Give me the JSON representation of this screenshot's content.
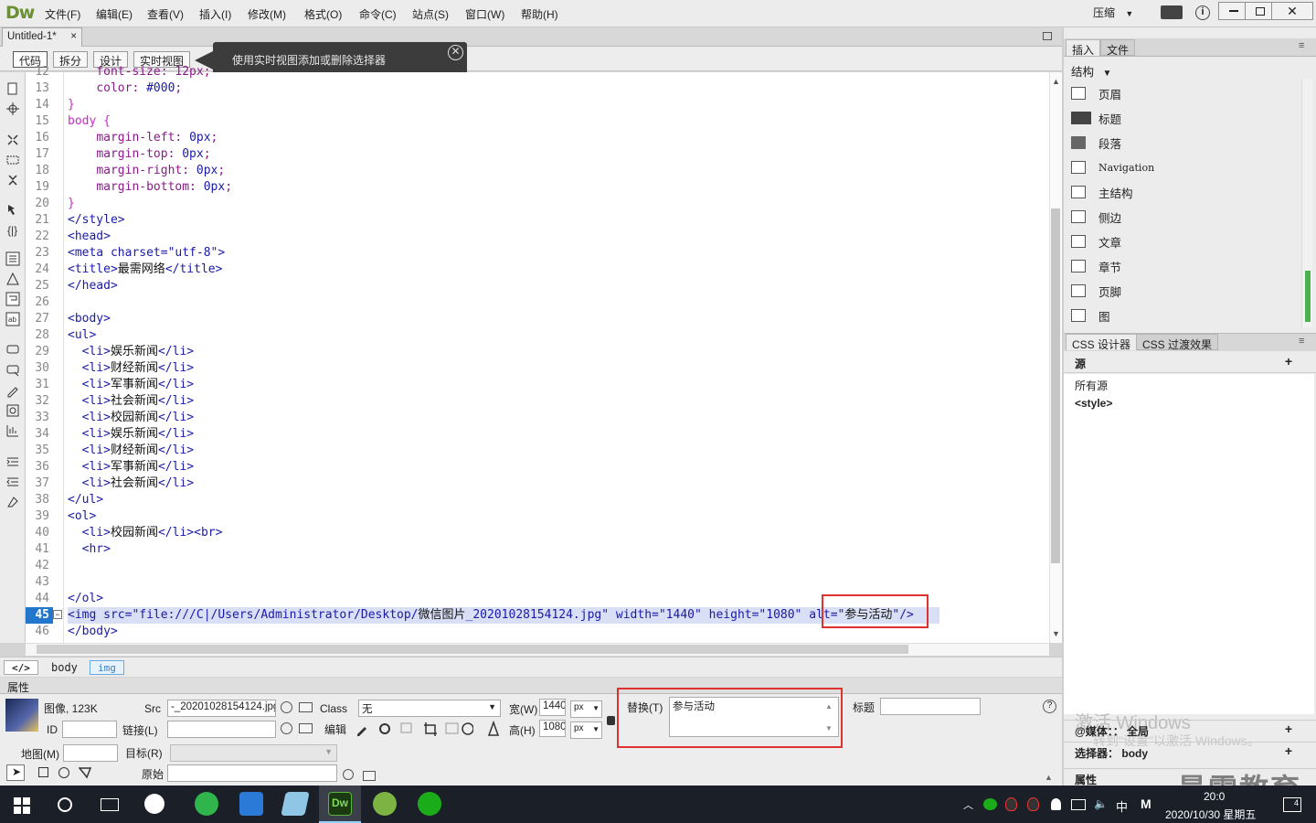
{
  "app": {
    "logo": "Dw",
    "layout_mode": "压缩"
  },
  "menu": [
    "文件(F)",
    "编辑(E)",
    "查看(V)",
    "插入(I)",
    "修改(M)",
    "格式(O)",
    "命令(C)",
    "站点(S)",
    "窗口(W)",
    "帮助(H)"
  ],
  "document": {
    "tab_title": "Untitled-1*",
    "close": "×"
  },
  "views": [
    "代码",
    "拆分",
    "设计",
    "实时视图"
  ],
  "tooltip": {
    "text": "使用实时视图添加或删除选择器",
    "close": "✕"
  },
  "code_lines": [
    {
      "n": "12",
      "indent": "    ",
      "parts": [
        [
          "prop",
          "font-size: 12px;"
        ]
      ]
    },
    {
      "n": "13",
      "indent": "    ",
      "parts": [
        [
          "prop",
          "color: "
        ],
        [
          "val",
          "#000"
        ],
        [
          "prop",
          ";"
        ]
      ]
    },
    {
      "n": "14",
      "indent": "",
      "parts": [
        [
          "sel",
          "}"
        ]
      ]
    },
    {
      "n": "15",
      "indent": "",
      "parts": [
        [
          "sel",
          "body {"
        ]
      ]
    },
    {
      "n": "16",
      "indent": "    ",
      "parts": [
        [
          "prop",
          "margin-left: "
        ],
        [
          "val",
          "0px"
        ],
        [
          "prop",
          ";"
        ]
      ]
    },
    {
      "n": "17",
      "indent": "    ",
      "parts": [
        [
          "prop",
          "margin-top: "
        ],
        [
          "val",
          "0px"
        ],
        [
          "prop",
          ";"
        ]
      ]
    },
    {
      "n": "18",
      "indent": "    ",
      "parts": [
        [
          "prop",
          "margin-right: "
        ],
        [
          "val",
          "0px"
        ],
        [
          "prop",
          ";"
        ]
      ]
    },
    {
      "n": "19",
      "indent": "    ",
      "parts": [
        [
          "prop",
          "margin-bottom: "
        ],
        [
          "val",
          "0px"
        ],
        [
          "prop",
          ";"
        ]
      ]
    },
    {
      "n": "20",
      "indent": "",
      "parts": [
        [
          "sel",
          "}"
        ]
      ]
    },
    {
      "n": "21",
      "indent": "",
      "parts": [
        [
          "tag",
          "</style>"
        ]
      ]
    },
    {
      "n": "22",
      "indent": "",
      "parts": [
        [
          "tag",
          "<head>"
        ]
      ]
    },
    {
      "n": "23",
      "indent": "",
      "parts": [
        [
          "tag",
          "<meta charset=\"utf-8\">"
        ]
      ]
    },
    {
      "n": "24",
      "indent": "",
      "parts": [
        [
          "tag",
          "<title>"
        ],
        [
          "txt",
          "最需网络"
        ],
        [
          "tag",
          "</title>"
        ]
      ]
    },
    {
      "n": "25",
      "indent": "",
      "parts": [
        [
          "tag",
          "</head>"
        ]
      ]
    },
    {
      "n": "26",
      "indent": "",
      "parts": []
    },
    {
      "n": "27",
      "indent": "",
      "parts": [
        [
          "tag",
          "<body>"
        ]
      ]
    },
    {
      "n": "28",
      "indent": "",
      "parts": [
        [
          "tag",
          "<ul>"
        ]
      ]
    },
    {
      "n": "29",
      "indent": "  ",
      "parts": [
        [
          "tag",
          "<li>"
        ],
        [
          "txt",
          "娱乐新闻"
        ],
        [
          "tag",
          "</li>"
        ]
      ]
    },
    {
      "n": "30",
      "indent": "  ",
      "parts": [
        [
          "tag",
          "<li>"
        ],
        [
          "txt",
          "财经新闻"
        ],
        [
          "tag",
          "</li>"
        ]
      ]
    },
    {
      "n": "31",
      "indent": "  ",
      "parts": [
        [
          "tag",
          "<li>"
        ],
        [
          "txt",
          "军事新闻"
        ],
        [
          "tag",
          "</li>"
        ]
      ]
    },
    {
      "n": "32",
      "indent": "  ",
      "parts": [
        [
          "tag",
          "<li>"
        ],
        [
          "txt",
          "社会新闻"
        ],
        [
          "tag",
          "</li>"
        ]
      ]
    },
    {
      "n": "33",
      "indent": "  ",
      "parts": [
        [
          "tag",
          "<li>"
        ],
        [
          "txt",
          "校园新闻"
        ],
        [
          "tag",
          "</li>"
        ]
      ]
    },
    {
      "n": "34",
      "indent": "  ",
      "parts": [
        [
          "tag",
          "<li>"
        ],
        [
          "txt",
          "娱乐新闻"
        ],
        [
          "tag",
          "</li>"
        ]
      ]
    },
    {
      "n": "35",
      "indent": "  ",
      "parts": [
        [
          "tag",
          "<li>"
        ],
        [
          "txt",
          "财经新闻"
        ],
        [
          "tag",
          "</li>"
        ]
      ]
    },
    {
      "n": "36",
      "indent": "  ",
      "parts": [
        [
          "tag",
          "<li>"
        ],
        [
          "txt",
          "军事新闻"
        ],
        [
          "tag",
          "</li>"
        ]
      ]
    },
    {
      "n": "37",
      "indent": "  ",
      "parts": [
        [
          "tag",
          "<li>"
        ],
        [
          "txt",
          "社会新闻"
        ],
        [
          "tag",
          "</li>"
        ]
      ]
    },
    {
      "n": "38",
      "indent": "",
      "parts": [
        [
          "tag",
          "</ul>"
        ]
      ]
    },
    {
      "n": "39",
      "indent": "",
      "parts": [
        [
          "tag",
          "<ol>"
        ]
      ]
    },
    {
      "n": "40",
      "indent": "  ",
      "parts": [
        [
          "tag",
          "<li>"
        ],
        [
          "txt",
          "校园新闻"
        ],
        [
          "tag",
          "</li><br>"
        ]
      ]
    },
    {
      "n": "41",
      "indent": "  ",
      "parts": [
        [
          "tag",
          "<hr>"
        ]
      ]
    },
    {
      "n": "42",
      "indent": "",
      "parts": []
    },
    {
      "n": "43",
      "indent": "",
      "parts": []
    },
    {
      "n": "44",
      "indent": "",
      "parts": [
        [
          "tag",
          "</ol>"
        ]
      ]
    },
    {
      "n": "45",
      "indent": "",
      "active": true,
      "parts": [
        [
          "tag",
          "<img src=\"file:///C|/Users/Administrator/Desktop/"
        ],
        [
          "txt",
          "微信图片"
        ],
        [
          "tag",
          "_20201028154124.jpg\" width=\"1440\" height=\"1080\" alt=\""
        ],
        [
          "txt",
          "参与活动"
        ],
        [
          "tag",
          "\"/>"
        ]
      ]
    },
    {
      "n": "46",
      "indent": "",
      "parts": [
        [
          "tag",
          "</body>"
        ]
      ]
    }
  ],
  "tag_selector": {
    "code_icon": "</>",
    "tags": [
      "body",
      "img"
    ]
  },
  "properties": {
    "title": "属性",
    "image_label": "图像, 123K",
    "id_label": "ID",
    "src_label": "Src",
    "src_value": "-_20201028154124.jpg",
    "link_label": "链接(L)",
    "class_label": "Class",
    "class_value": "无",
    "edit_label": "编辑",
    "width_label": "宽(W)",
    "width_value": "1440",
    "height_label": "高(H)",
    "height_value": "1080",
    "unit": "px",
    "alt_label": "替换(T)",
    "alt_value": "参与活动",
    "title_label": "标题",
    "map_label": "地图(M)",
    "target_label": "目标(R)",
    "original_label": "原始"
  },
  "right_panel": {
    "tabs": [
      "插入",
      "文件"
    ],
    "category": "结构",
    "insert_items": [
      "页眉",
      "标题",
      "段落",
      "Navigation",
      "主结构",
      "侧边",
      "文章",
      "章节",
      "页脚",
      "图"
    ],
    "css_tabs": [
      "CSS 设计器",
      "CSS 过渡效果"
    ],
    "source_label": "源",
    "all_sources": "所有源",
    "style_item": "<style>",
    "media_label": "@媒体：：",
    "media_value": "全局",
    "selector_label": "选择器：",
    "selector_value": "body",
    "props_label": "属性"
  },
  "watermark": {
    "line1": "激活 Windows",
    "line2": "转到\"设置\"以激活 Windows。",
    "brand": "最需教育"
  },
  "taskbar": {
    "time": "20:0",
    "date": "2020/10/30 星期五",
    "ime": "中",
    "badge": "4"
  },
  "colors": {
    "accent_blue": "#2277cc",
    "highlight_red": "#e03131",
    "taskbar": "#1b1f28"
  }
}
